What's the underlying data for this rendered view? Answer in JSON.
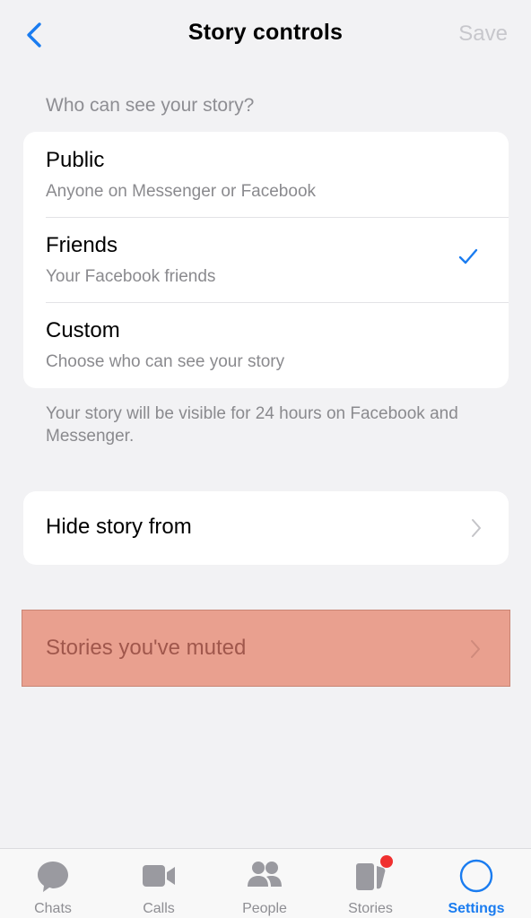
{
  "nav": {
    "title": "Story controls",
    "save_label": "Save"
  },
  "privacy": {
    "header": "Who can see your story?",
    "options": [
      {
        "title": "Public",
        "subtitle": "Anyone on Messenger or Facebook",
        "selected": false
      },
      {
        "title": "Friends",
        "subtitle": "Your Facebook friends",
        "selected": true
      },
      {
        "title": "Custom",
        "subtitle": "Choose who can see your story",
        "selected": false
      }
    ],
    "footnote": "Your story will be visible for 24 hours on Facebook and Messenger."
  },
  "hide_story": {
    "label": "Hide story from"
  },
  "muted_stories": {
    "label": "Stories you've muted"
  },
  "tabbar": {
    "tabs": [
      {
        "label": "Chats",
        "icon": "chat-bubble-icon"
      },
      {
        "label": "Calls",
        "icon": "video-camera-icon"
      },
      {
        "label": "People",
        "icon": "people-icon"
      },
      {
        "label": "Stories",
        "icon": "stories-icon"
      },
      {
        "label": "Settings",
        "icon": "settings-circle-icon"
      }
    ],
    "active": "Settings"
  },
  "colors": {
    "accent": "#1a7cf0",
    "background": "#f2f2f4",
    "secondary_text": "#8a8a8e",
    "highlight": "#e9a08f",
    "badge": "#f0302f"
  }
}
